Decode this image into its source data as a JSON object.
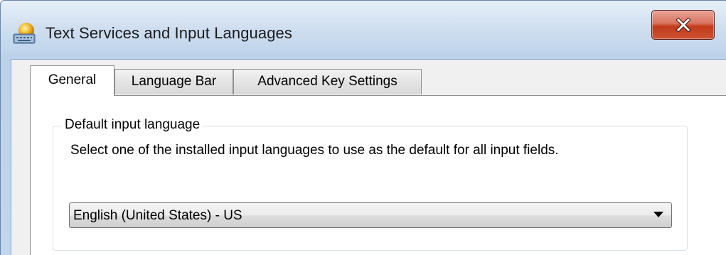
{
  "window": {
    "title": "Text Services and Input Languages",
    "icon": "keyboard-globe-icon",
    "close_icon": "close-x-icon",
    "close_button_color": "#c94a2c"
  },
  "tabs": [
    {
      "label": "General",
      "active": true
    },
    {
      "label": "Language Bar",
      "active": false
    },
    {
      "label": "Advanced Key Settings",
      "active": false
    }
  ],
  "general": {
    "group_title": "Default input language",
    "description": "Select one of the installed input languages to use as the default for all input fields.",
    "dropdown": {
      "selected": "English (United States) - US",
      "arrow_icon": "chevron-down-icon"
    }
  }
}
